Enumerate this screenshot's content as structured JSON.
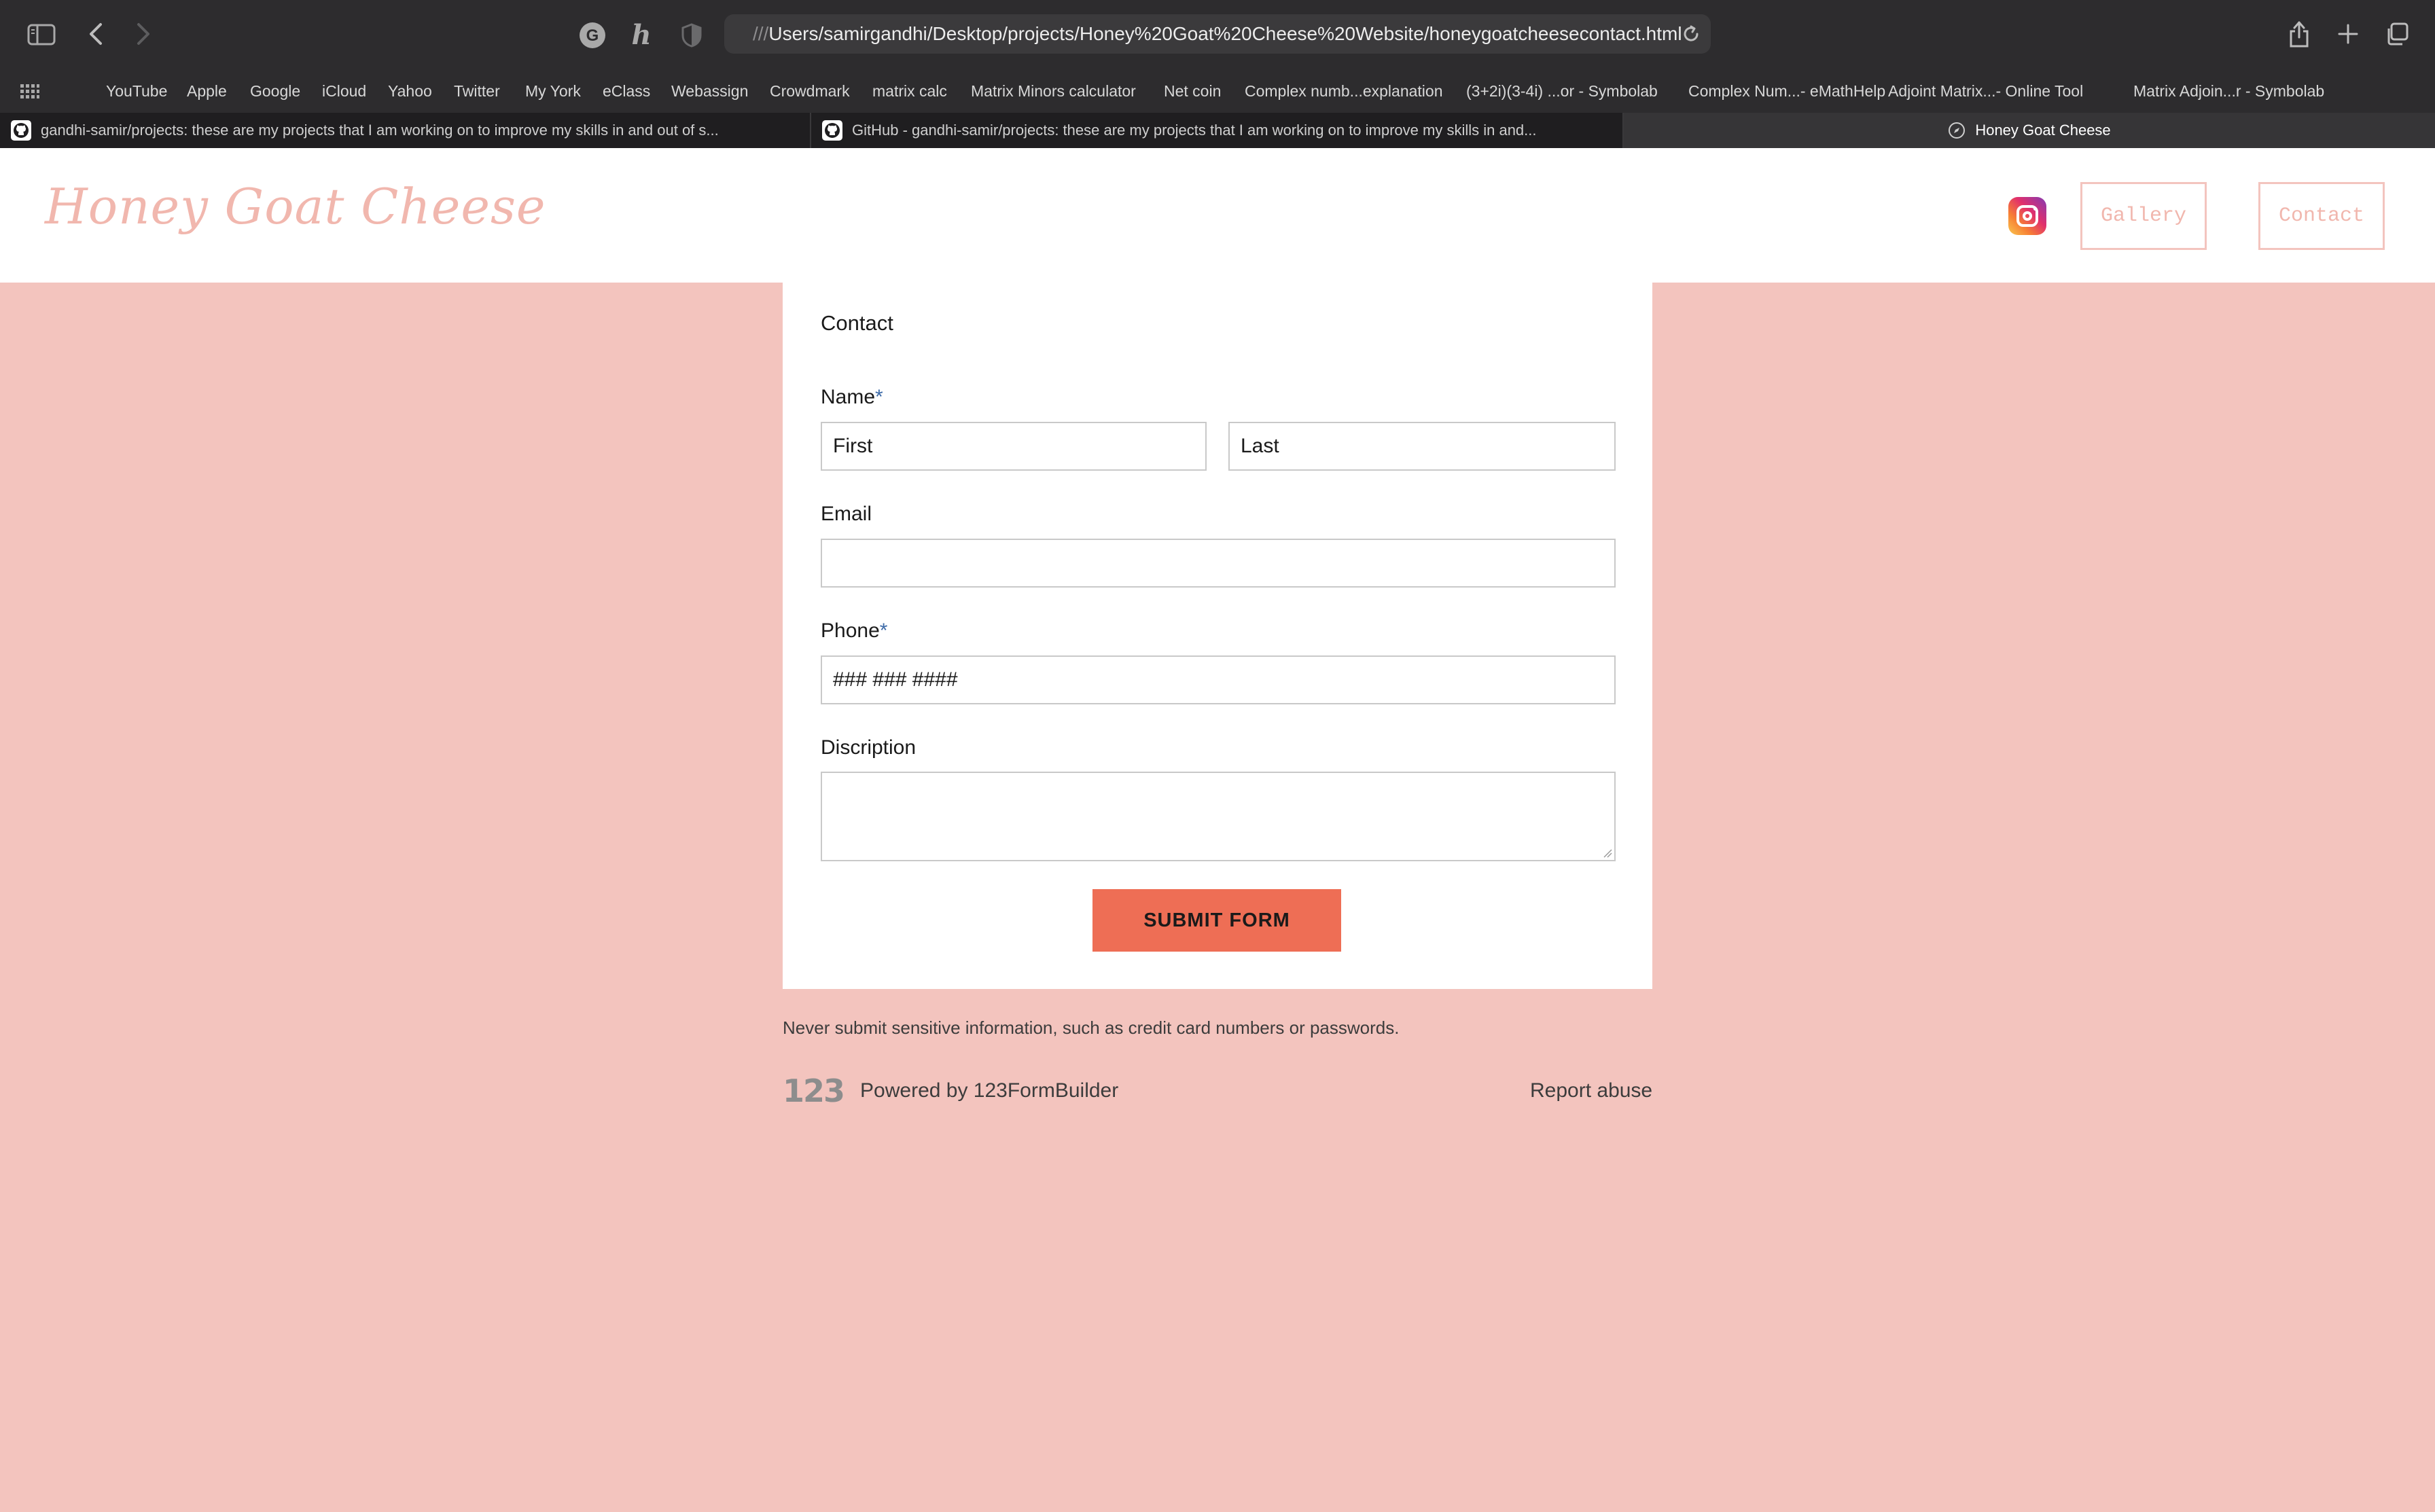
{
  "browser": {
    "url_prefix": "///",
    "url": "Users/samirgandhi/Desktop/projects/Honey%20Goat%20Cheese%20Website/honeygoatcheesecontact.html",
    "toolbar_icons": [
      "sidebar-icon",
      "back-icon",
      "forward-icon",
      "grammarly-icon",
      "honey-icon",
      "shield-icon",
      "reload-icon",
      "share-icon",
      "new-tab-icon",
      "tabs-overview-icon"
    ]
  },
  "bookmarks": [
    "YouTube",
    "Apple",
    "Google",
    "iCloud",
    "Yahoo",
    "Twitter",
    "My York",
    "eClass",
    "Webassign",
    "Crowdmark",
    "matrix calc",
    "Matrix Minors calculator",
    "Net coin",
    "Complex numb...explanation",
    "(3+2i)(3-4i) ...or - Symbolab",
    "Complex Num...- eMathHelp",
    "Adjoint Matrix...- Online Tool",
    "Matrix Adjoin...r - Symbolab"
  ],
  "tabs": [
    {
      "title": "gandhi-samir/projects: these are my projects that I am working on to improve my skills in and out of s..."
    },
    {
      "title": "GitHub - gandhi-samir/projects: these are my projects that I am working on to improve my skills in and..."
    },
    {
      "title": "Honey Goat Cheese"
    }
  ],
  "site": {
    "logo": "Honey Goat Cheese",
    "nav": {
      "gallery": "Gallery",
      "contact": "Contact"
    },
    "colors": {
      "background": "#f3c4be",
      "accent": "#ee6e55",
      "logo": "#f1b7ae"
    }
  },
  "form": {
    "title": "Contact",
    "name_label": "Name",
    "required_mark": "*",
    "first_placeholder": "First",
    "last_placeholder": "Last",
    "email_label": "Email",
    "email_placeholder": "",
    "phone_label": "Phone",
    "phone_placeholder": "### ### ####",
    "description_label": "Discription",
    "submit_label": "SUBMIT FORM"
  },
  "footer": {
    "notice": "Never submit sensitive information, such as credit card numbers or passwords.",
    "builder_logo": "123",
    "powered_by": "Powered by 123FormBuilder",
    "report": "Report abuse"
  }
}
